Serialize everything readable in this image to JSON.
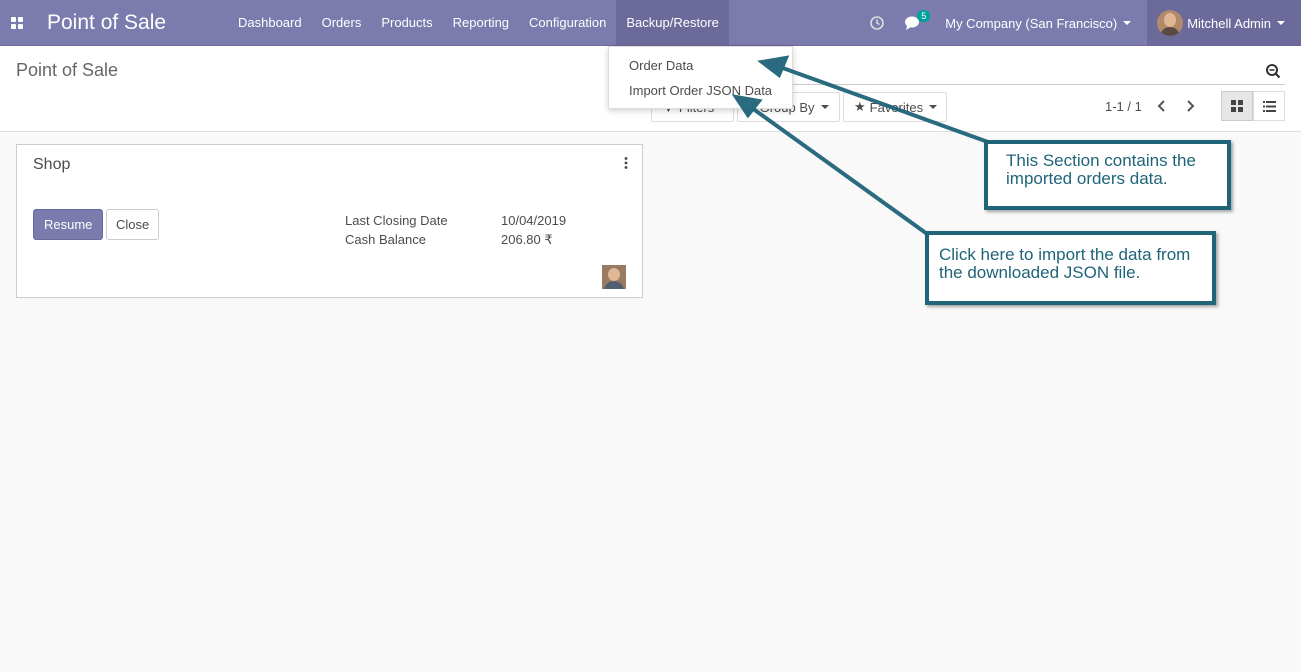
{
  "navbar": {
    "brand": "Point of Sale",
    "menu": [
      "Dashboard",
      "Orders",
      "Products",
      "Reporting",
      "Configuration",
      "Backup/Restore"
    ],
    "chat_count": "5",
    "company": "My Company (San Francisco)",
    "user": "Mitchell Admin"
  },
  "dropdown": {
    "items": [
      "Order Data",
      "Import Order JSON Data"
    ]
  },
  "control": {
    "breadcrumb": "Point of Sale",
    "filters_label": "Filters",
    "groupby_label": "Group By",
    "favorites_label": "Favorites",
    "pager": "1-1 / 1"
  },
  "card": {
    "title": "Shop",
    "resume_label": "Resume",
    "close_label": "Close",
    "stats": [
      {
        "label": "Last Closing Date",
        "value": "10/04/2019"
      },
      {
        "label": "Cash Balance",
        "value": "206.80 ₹"
      }
    ]
  },
  "callouts": {
    "first": "This Section contains the imported orders data.",
    "second": "Click here to import the data from the downloaded JSON file."
  },
  "colors": {
    "brand": "#7c7bad",
    "brand_dark": "#6b6a9b",
    "callout": "#1f6479",
    "badge": "#00a09d"
  }
}
